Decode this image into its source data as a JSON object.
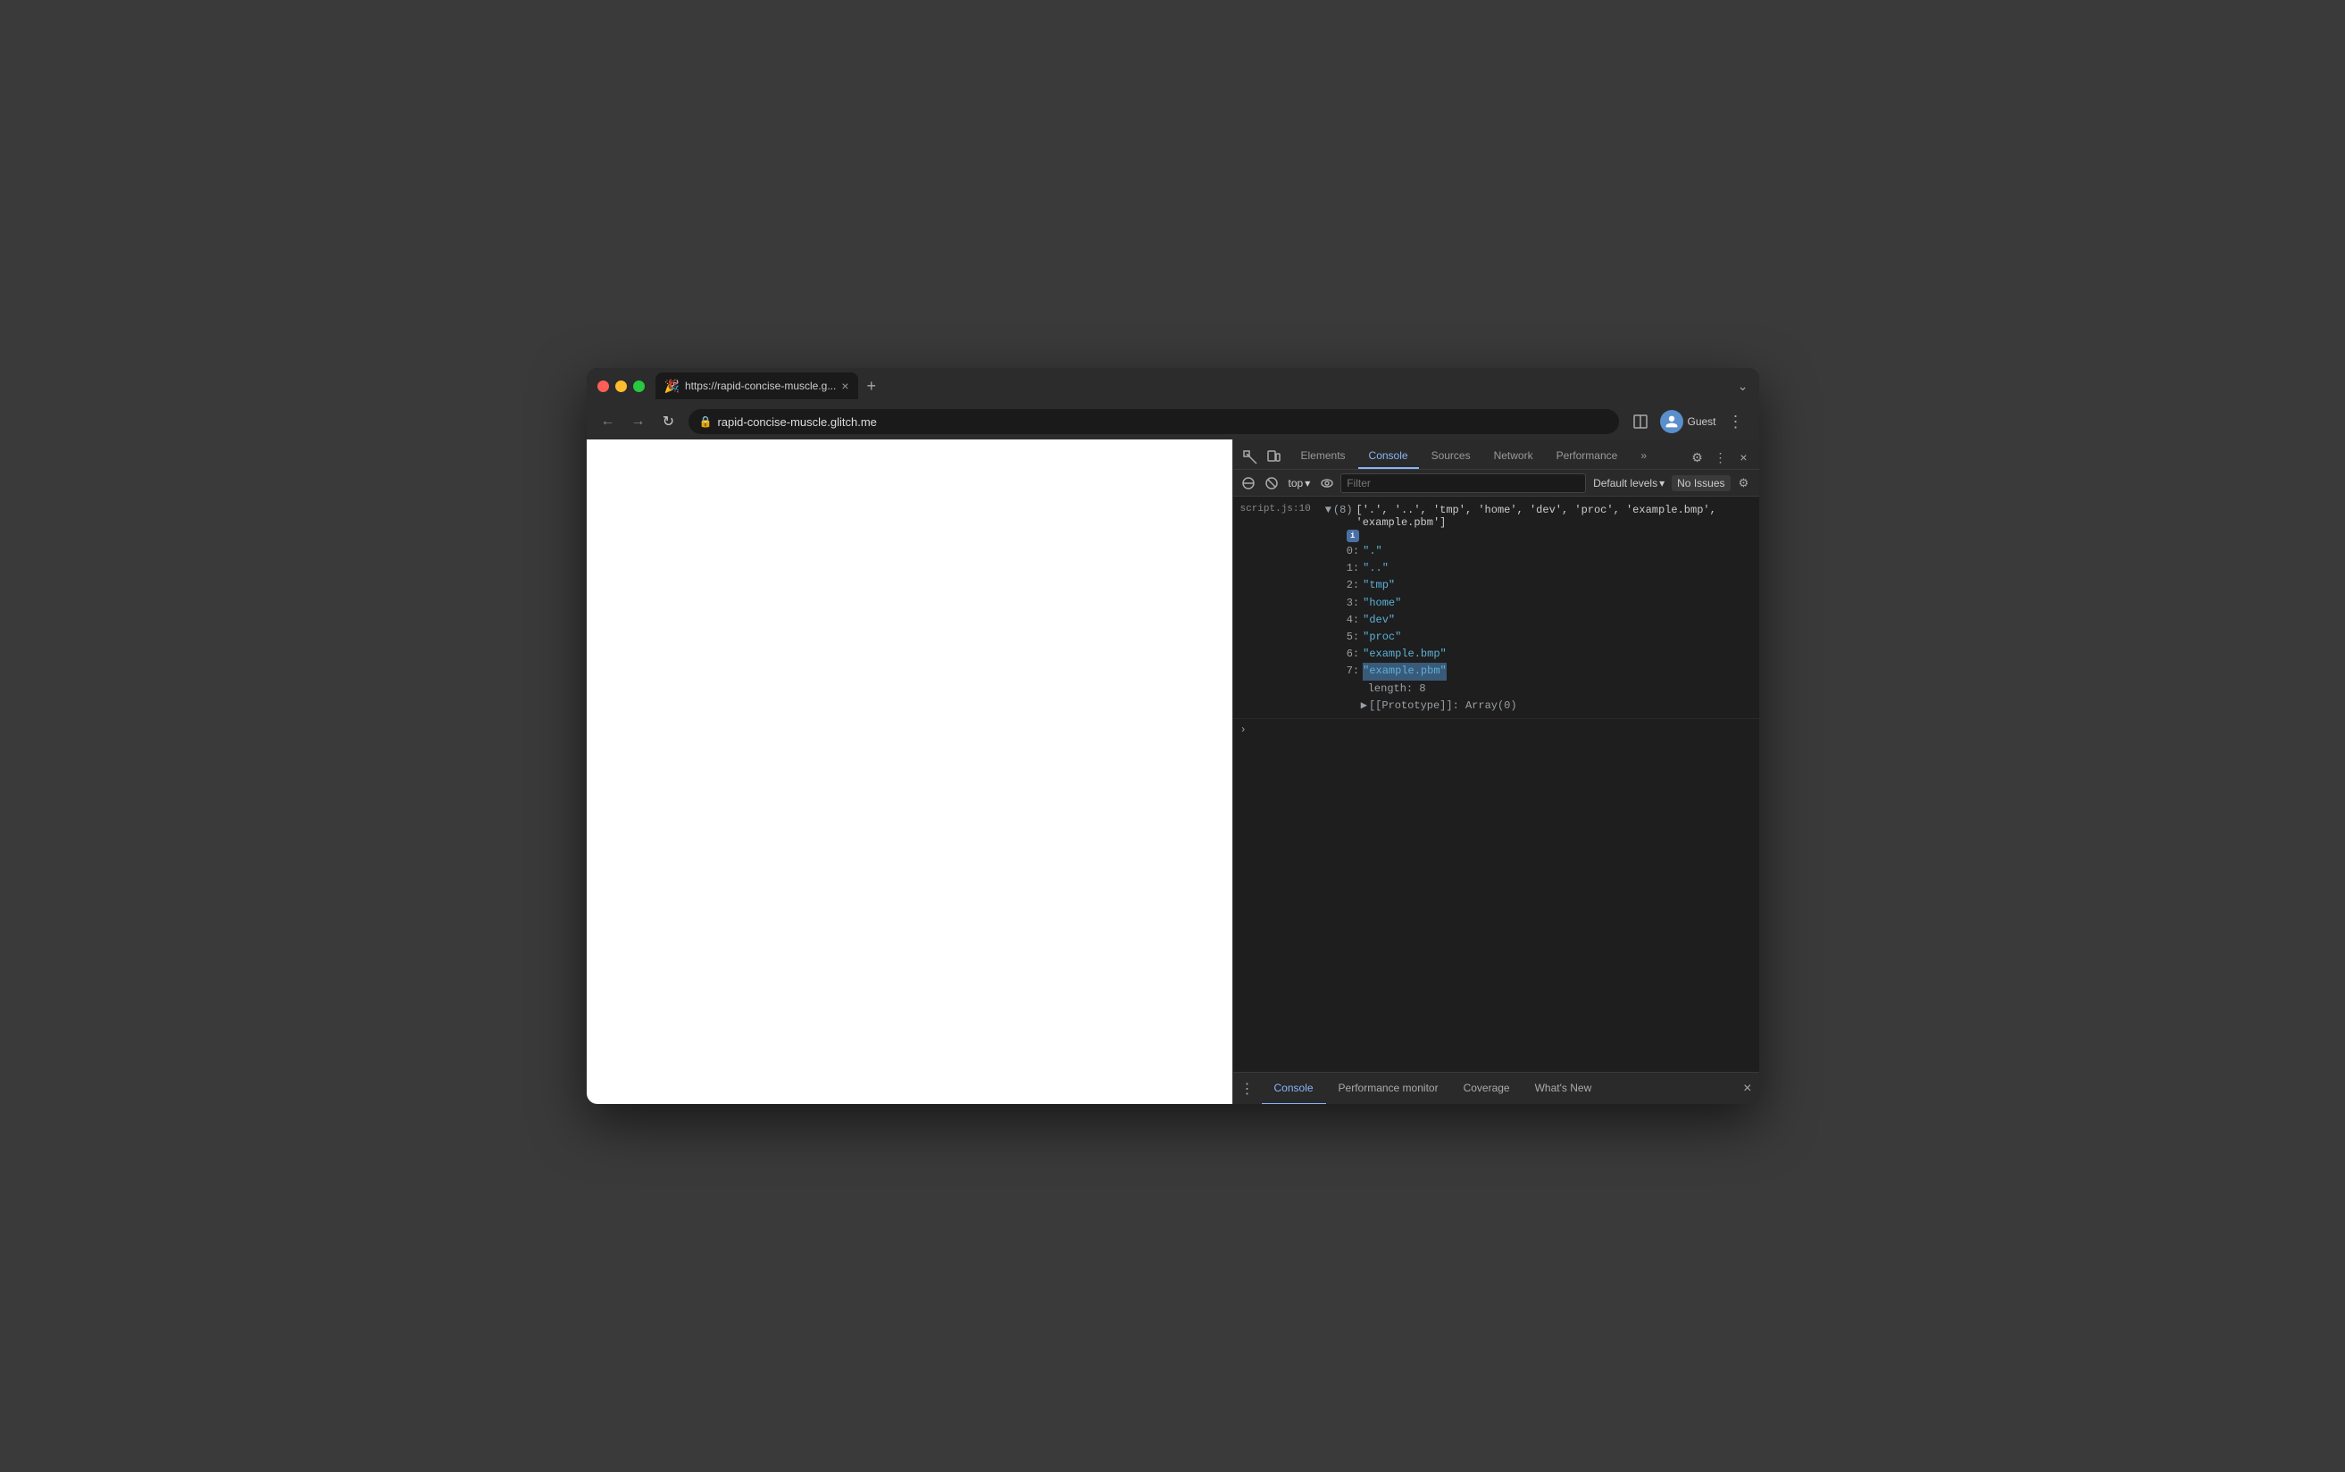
{
  "browser": {
    "traffic_lights": [
      "close",
      "minimize",
      "maximize"
    ],
    "tab": {
      "favicon": "🎉",
      "title": "https://rapid-concise-muscle.g...",
      "close": "×"
    },
    "new_tab": "+",
    "chevron": "⌄",
    "address": "rapid-concise-muscle.glitch.me",
    "nav": {
      "back": "←",
      "forward": "→",
      "refresh": "↻"
    }
  },
  "devtools": {
    "tabs": [
      "Elements",
      "Console",
      "Sources",
      "Network",
      "Performance"
    ],
    "active_tab": "Console",
    "more_tabs": "»",
    "icons": {
      "inspect": "⬚",
      "device": "▭",
      "settings": "⚙",
      "more": "⋮",
      "close": "×"
    },
    "console_toolbar": {
      "ban": "🚫",
      "context": "top",
      "context_arrow": "▾",
      "eye": "👁",
      "filter_placeholder": "Filter",
      "default_levels": "Default levels",
      "default_levels_arrow": "▾",
      "no_issues": "No Issues",
      "settings": "⚙"
    },
    "source_link": "script.js:10",
    "log": {
      "array_count": "(8)",
      "array_preview": "['.',  '..', 'tmp', 'home', 'dev', 'proc', 'example.bmp', 'example.pbm']",
      "info_badge": "i",
      "items": [
        {
          "key": "0:",
          "val": "\".\""
        },
        {
          "key": "1:",
          "val": "\"..\""
        },
        {
          "key": "2:",
          "val": "\"tmp\""
        },
        {
          "key": "3:",
          "val": "\"home\""
        },
        {
          "key": "4:",
          "val": "\"dev\""
        },
        {
          "key": "5:",
          "val": "\"proc\""
        },
        {
          "key": "6:",
          "val": "\"example.bmp\""
        },
        {
          "key": "7:",
          "val": "\"example.pbm\"",
          "highlighted": true
        }
      ],
      "length_key": "length:",
      "length_val": "8",
      "prototype": "[[Prototype]]: Array(0)"
    }
  },
  "bottom_tabs": {
    "dots": "⋮",
    "items": [
      "Console",
      "Performance monitor",
      "Coverage",
      "What's New"
    ],
    "active": "Console",
    "close": "×"
  }
}
